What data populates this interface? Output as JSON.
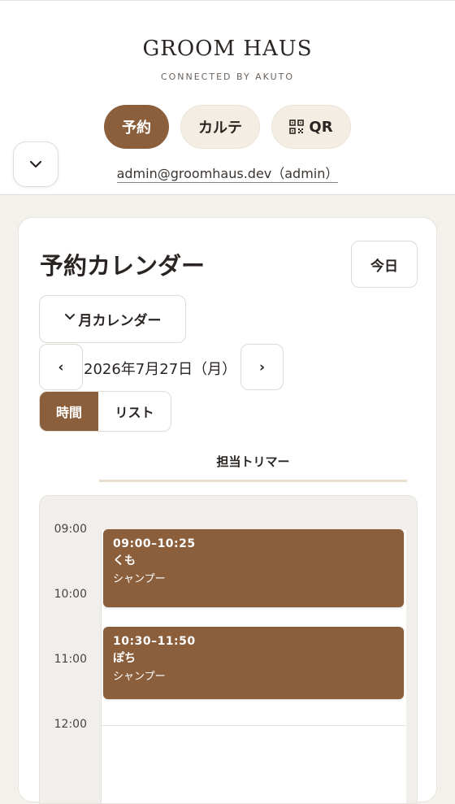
{
  "header": {
    "brand": "GROOM HAUS",
    "tagline": "CONNECTED BY AKUTO",
    "nav": {
      "reserve": "予約",
      "karte": "カルテ",
      "qr": "QR"
    },
    "account": "admin@groomhaus.dev（admin）",
    "collapse_icon": "chevron-down-icon"
  },
  "calendar": {
    "title": "予約カレンダー",
    "today_label": "今日",
    "month_toggle_label": "月カレンダー",
    "prev_label": "‹",
    "next_label": "›",
    "date": "2026年7月27日（月）",
    "views": {
      "time": "時間",
      "list": "リスト"
    },
    "active_view": "時間",
    "column_header": "担当トリマー",
    "hours": [
      "09:00",
      "10:00",
      "11:00",
      "12:00"
    ],
    "events": [
      {
        "time": "09:00–10:25",
        "pet": "くも",
        "service": "シャンプー"
      },
      {
        "time": "10:30–11:50",
        "pet": "ぽち",
        "service": "シャンプー"
      }
    ]
  },
  "colors": {
    "accent": "#8b5f3c",
    "background": "#f3f1ec",
    "pill_bg": "#f3ede3"
  }
}
